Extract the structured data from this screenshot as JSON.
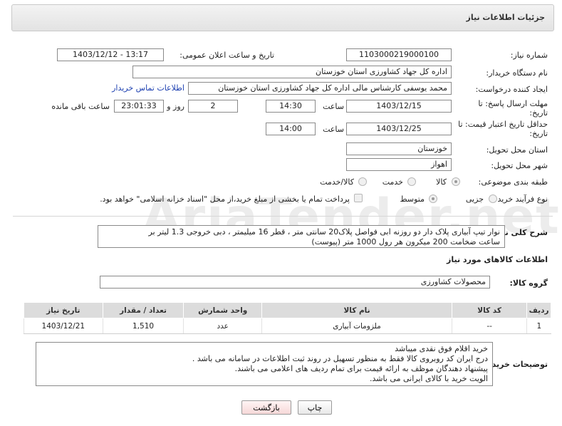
{
  "panel": {
    "title": "جزئیات اطلاعات نیاز"
  },
  "form": {
    "need_number_label": "شماره نیاز:",
    "need_number": "1103000219000100",
    "announce_label": "تاریخ و ساعت اعلان عمومی:",
    "announce_value": "1403/12/12 - 13:17",
    "buyer_org_label": "نام دستگاه خریدار:",
    "buyer_org": "اداره کل جهاد کشاورزی استان خوزستان",
    "creator_label": "ایجاد کننده درخواست:",
    "creator": "محمد یوسفی کارشناس مالی اداره کل جهاد کشاورزی استان خوزستان",
    "contact_link": "اطلاعات تماس خریدار",
    "reply_deadline_label_1": "مهلت ارسال پاسخ: تا",
    "reply_deadline_label_2": "تاریخ:",
    "reply_date": "1403/12/15",
    "time_label": "ساعت",
    "reply_time": "14:30",
    "days_value": "2",
    "days_label": "روز و",
    "remaining_time": "23:01:33",
    "remaining_label": "ساعت باقی مانده",
    "price_valid_label_1": "حداقل تاریخ اعتبار قیمت: تا",
    "price_valid_label_2": "تاریخ:",
    "price_date": "1403/12/25",
    "price_time": "14:00",
    "province_label": "استان محل تحویل:",
    "province": "خوزستان",
    "city_label": "شهر محل تحویل:",
    "city": "اهواز",
    "category_label": "طبقه بندی موضوعی:",
    "category_options": [
      "کالا",
      "خدمت",
      "کالا/خدمت"
    ],
    "process_label": "نوع فرآیند خرید :",
    "process_options": [
      "جزیی",
      "متوسط"
    ],
    "payment_note": "پرداخت تمام یا بخشی از مبلغ خرید،از محل \"اسناد خزانه اسلامی\" خواهد بود."
  },
  "summary": {
    "label": "شرح کلی نیاز:",
    "text_1": "نوار تیپ آبیاری پلاک دار دو روزنه ابی فواصل پلاک20 سانتی متر ، قطر 16 میلیمتر ، دبی خروجی 1.3  لیتر بر",
    "text_2": "ساعت ضخامت 200 میکرون هر رول 1000 متر (پیوست)"
  },
  "goods": {
    "heading": "اطلاعات کالاهای مورد نیاز",
    "group_label": "گروه کالا:",
    "group_value": "محصولات کشاورزی",
    "columns": [
      "ردیف",
      "کد کالا",
      "نام کالا",
      "واحد شمارش",
      "تعداد / مقدار",
      "تاریخ نیاز"
    ],
    "rows": [
      {
        "index": "1",
        "code": "--",
        "name": "ملزومات آبیاری",
        "unit": "عدد",
        "qty": "1,510",
        "date": "1403/12/21"
      }
    ]
  },
  "buyer_notes": {
    "label": "توضیحات خریدار:",
    "lines": [
      "خرید اقلام فوق نقدی میباشد",
      "درج ایران کد روبروی کالا فقط به منظور تسهیل در روند ثبت اطلاعات در سامانه می باشد .",
      "پیشنهاد دهندگان موظف به ارائه قیمت برای تمام ردیف های اعلامی می باشند.",
      "الویت خرید با کالای ایرانی می باشد."
    ]
  },
  "buttons": {
    "print": "چاپ",
    "back": "بازگشت"
  },
  "watermark": "AriaTender.net"
}
